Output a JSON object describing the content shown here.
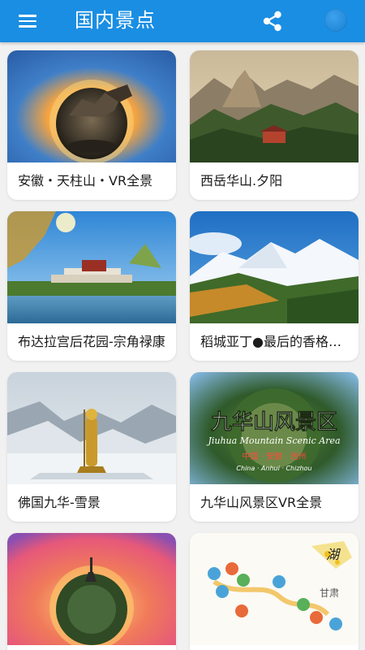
{
  "header": {
    "title": "国内景点",
    "menu_icon": "hamburger-menu-icon",
    "share_icon": "share-icon",
    "accent": "#1a8ee3"
  },
  "spots": [
    {
      "label": "安徽・天柱山・VR全景"
    },
    {
      "label": "西岳华山.夕阳"
    },
    {
      "label": "布达拉宫后花园-宗角禄康"
    },
    {
      "label": "稻城亚丁●最后的香格里拉"
    },
    {
      "label": "佛国九华-雪景"
    },
    {
      "label": "九华山风景区VR全景"
    },
    {
      "label": ""
    },
    {
      "label": ""
    }
  ],
  "thumb_text": {
    "jiuhua_title": "九华山风景区",
    "jiuhua_en": "Jiuhua Mountain Scenic Area",
    "jiuhua_loc_cn": "中国 · 安徽 · 池州",
    "jiuhua_loc_en": "China · Anhui · Chizhou",
    "map_region": "甘肃",
    "map_logo": "湖"
  }
}
